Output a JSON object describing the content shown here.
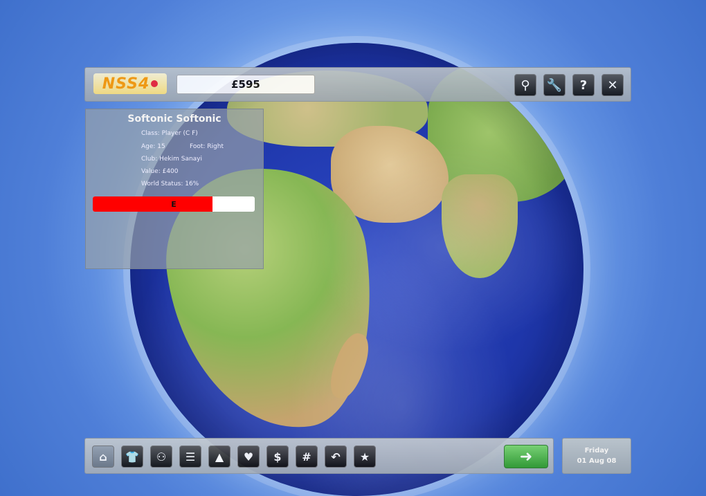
{
  "header": {
    "logo_text": "NSS4",
    "money": "£595",
    "icons": [
      "search-icon",
      "wrench-icon",
      "help-icon",
      "close-icon"
    ],
    "icon_glyphs": [
      "⚲",
      "🔧",
      "?",
      "✕"
    ]
  },
  "player": {
    "name": "Softonic Softonic",
    "class": "Class: Player (C F)",
    "age": "Age: 15",
    "foot": "Foot: Right",
    "club": "Club: Hekim Sanayi",
    "value": "Value: £400",
    "world_status": "World Status: 16%",
    "rating_grade": "E",
    "rating_fill": 0.74,
    "rating_color": "#ff0000"
  },
  "bottom_nav": {
    "icons": [
      "home-icon",
      "shirt-icon",
      "team-icon",
      "list-icon",
      "podium-icon",
      "heart-icon",
      "money-icon",
      "hash-icon",
      "swap-icon",
      "star-icon"
    ],
    "glyphs": [
      "⌂",
      "👕",
      "⚇",
      "☰",
      "▲",
      "♥",
      "$",
      "#",
      "↶",
      "★"
    ],
    "next_glyph": "➜"
  },
  "date": {
    "day": "Friday",
    "date": "01 Aug 08"
  }
}
